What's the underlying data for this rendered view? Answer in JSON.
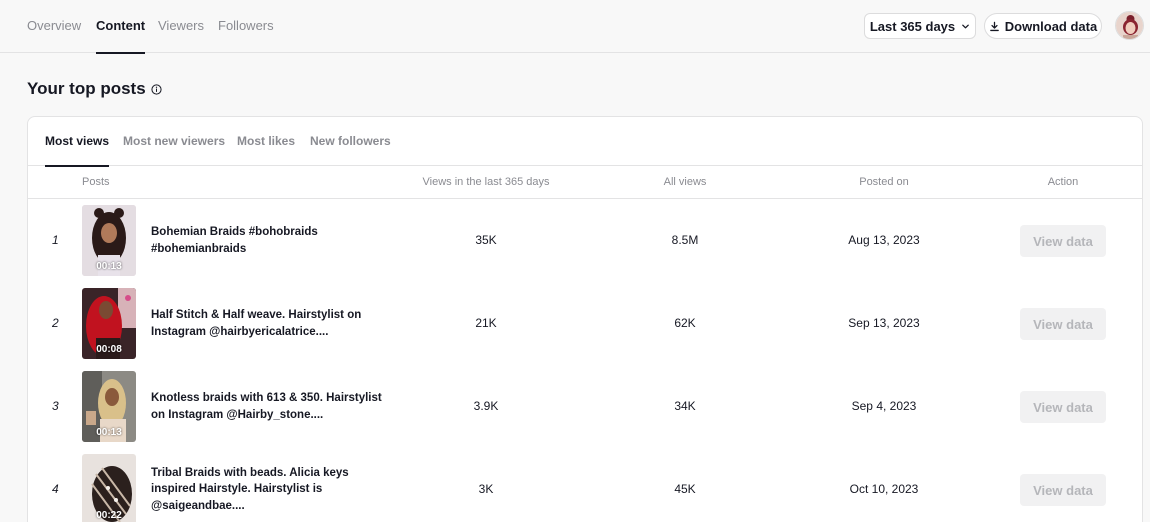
{
  "nav": {
    "tabs": [
      {
        "label": "Overview",
        "active": false
      },
      {
        "label": "Content",
        "active": true
      },
      {
        "label": "Viewers",
        "active": false
      },
      {
        "label": "Followers",
        "active": false
      }
    ],
    "range_label": "Last 365 days",
    "download_label": "Download data"
  },
  "section": {
    "title": "Your top posts",
    "info_icon": "info-icon"
  },
  "subtabs": [
    {
      "label": "Most views",
      "active": true
    },
    {
      "label": "Most new viewers",
      "active": false
    },
    {
      "label": "Most likes",
      "active": false
    },
    {
      "label": "New followers",
      "active": false
    }
  ],
  "table": {
    "headers": {
      "posts": "Posts",
      "views_365": "Views in the last 365 days",
      "all_views": "All views",
      "posted_on": "Posted on",
      "action": "Action"
    },
    "rows": [
      {
        "rank": "1",
        "duration": "00:13",
        "title": "Bohemian Braids #bohobraids #bohemianbraids",
        "views_365": "35K",
        "all_views": "8.5M",
        "posted_on": "Aug 13, 2023",
        "action": "View data"
      },
      {
        "rank": "2",
        "duration": "00:08",
        "title": "Half Stitch & Half weave. Hairstylist on Instagram @hairbyericalatrice....",
        "views_365": "21K",
        "all_views": "62K",
        "posted_on": "Sep 13, 2023",
        "action": "View data"
      },
      {
        "rank": "3",
        "duration": "00:13",
        "title": "Knotless braids with 613 & 350. Hairstylist on Instagram @Hairby_stone....",
        "views_365": "3.9K",
        "all_views": "34K",
        "posted_on": "Sep 4, 2023",
        "action": "View data"
      },
      {
        "rank": "4",
        "duration": "00:22",
        "title": "Tribal Braids with beads. Alicia keys inspired Hairstyle. Hairstylist is @saigeandbae....",
        "views_365": "3K",
        "all_views": "45K",
        "posted_on": "Oct 10, 2023",
        "action": "View data"
      }
    ]
  },
  "colors": {
    "text": "#161823",
    "muted": "#8a8b91",
    "border": "#e3e3e4",
    "disabled_button_bg": "#f1f1f2",
    "disabled_button_text": "#b5b6ba"
  }
}
